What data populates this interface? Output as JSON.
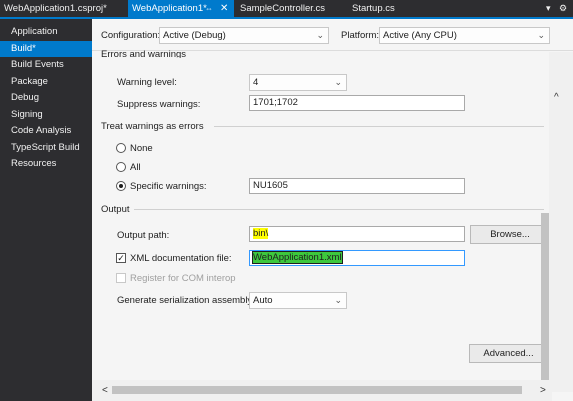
{
  "tabs": [
    {
      "label": "WebApplication1.csproj*"
    },
    {
      "label": "WebApplication1*",
      "pin": "⇔",
      "close": "✕"
    },
    {
      "label": "SampleController.cs"
    },
    {
      "label": "Startup.cs"
    }
  ],
  "tab_controls": {
    "dropdown": "▾",
    "settings": "⚙"
  },
  "sidebar": {
    "items": [
      {
        "label": "Application"
      },
      {
        "label": "Build*"
      },
      {
        "label": "Build Events"
      },
      {
        "label": "Package"
      },
      {
        "label": "Debug"
      },
      {
        "label": "Signing"
      },
      {
        "label": "Code Analysis"
      },
      {
        "label": "TypeScript Build"
      },
      {
        "label": "Resources"
      }
    ]
  },
  "config": {
    "configuration_label": "Configuration:",
    "configuration_value": "Active (Debug)",
    "platform_label": "Platform:",
    "platform_value": "Active (Any CPU)"
  },
  "errors": {
    "section_title": "Errors and warnings",
    "warning_level_label": "Warning level:",
    "warning_level_value": "4",
    "suppress_label": "Suppress warnings:",
    "suppress_value": "1701;1702"
  },
  "treat_warnings": {
    "section_title": "Treat warnings as errors",
    "none_label": "None",
    "all_label": "All",
    "specific_label": "Specific warnings:",
    "specific_value": "NU1605",
    "selected": "specific"
  },
  "output": {
    "section_title": "Output",
    "output_path_label": "Output path:",
    "output_path_value": "bin\\",
    "browse_label": "Browse...",
    "xml_doc_label": "XML documentation file:",
    "xml_doc_value": "WebApplication1.xml",
    "xml_doc_checked": "✓",
    "com_interop_label": "Register for COM interop",
    "serialization_label": "Generate serialization assembly:",
    "serialization_value": "Auto",
    "advanced_label": "Advanced..."
  },
  "scroll": {
    "up": "^",
    "left": "<",
    "right": ">"
  }
}
